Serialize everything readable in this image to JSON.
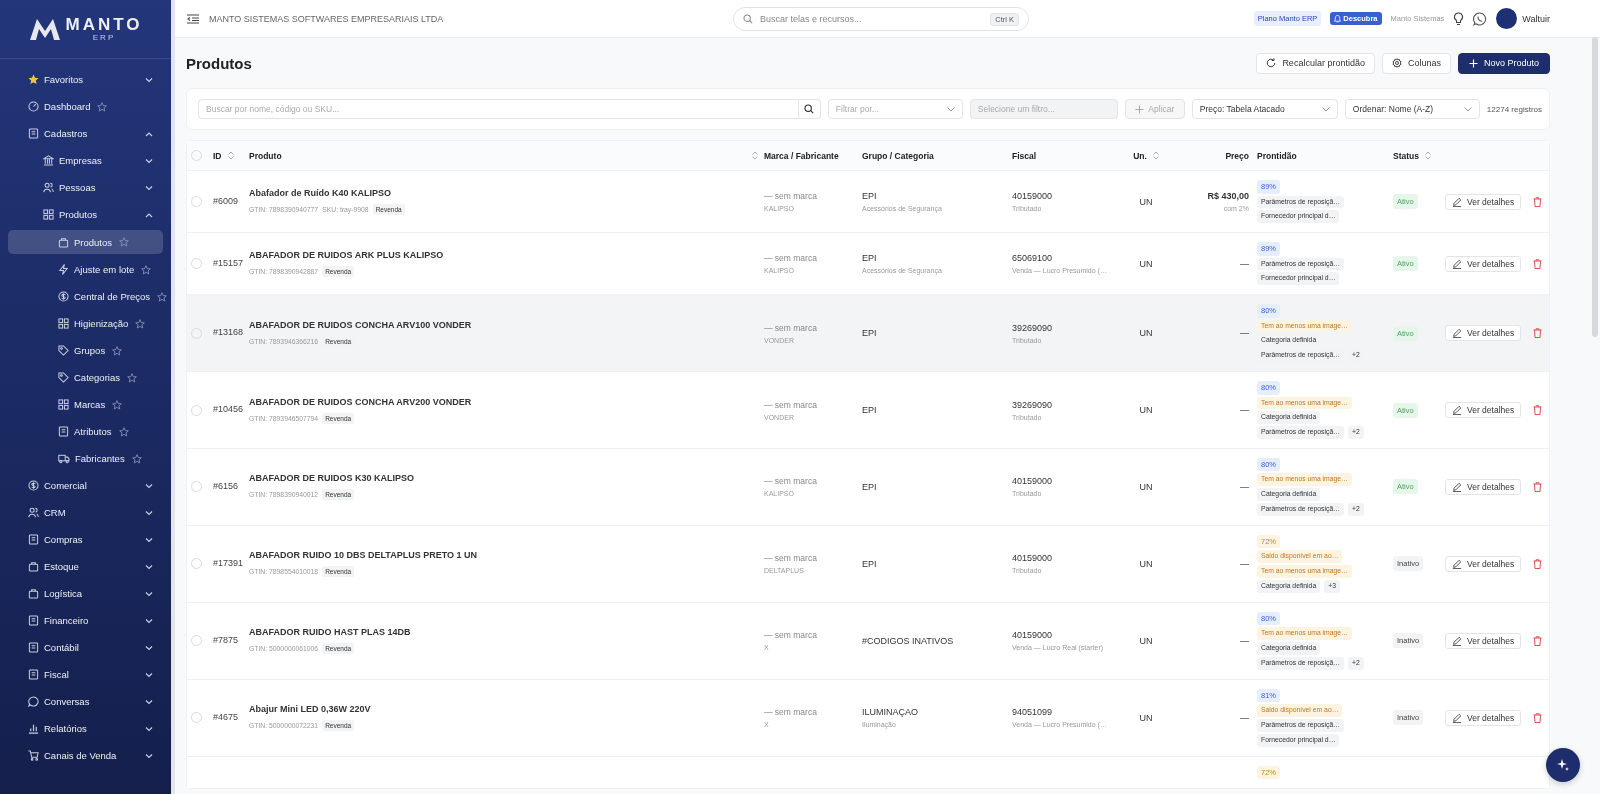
{
  "sidebar": {
    "logo": {
      "name": "MANTO",
      "sub": "ERP"
    },
    "items": [
      {
        "kind": "group",
        "label": "Favoritos",
        "expanded": false
      },
      {
        "kind": "link",
        "label": "Dashboard",
        "selected": false
      },
      {
        "kind": "group",
        "label": "Cadastros",
        "expanded": true,
        "children": [
          {
            "kind": "group",
            "label": "Empresas",
            "expanded": false
          },
          {
            "kind": "group",
            "label": "Pessoas",
            "expanded": false
          },
          {
            "kind": "group",
            "label": "Produtos",
            "expanded": true,
            "children": [
              {
                "kind": "link",
                "label": "Produtos",
                "selected": true
              },
              {
                "kind": "link",
                "label": "Ajuste em lote",
                "selected": false
              },
              {
                "kind": "link",
                "label": "Central de Preços",
                "selected": false
              },
              {
                "kind": "link",
                "label": "Higienização",
                "selected": false
              },
              {
                "kind": "link",
                "label": "Grupos",
                "selected": false
              },
              {
                "kind": "link",
                "label": "Categorias",
                "selected": false
              },
              {
                "kind": "link",
                "label": "Marcas",
                "selected": false
              },
              {
                "kind": "link",
                "label": "Atributos",
                "selected": false
              },
              {
                "kind": "link",
                "label": "Fabricantes",
                "selected": false
              }
            ]
          }
        ]
      },
      {
        "kind": "group",
        "label": "Comercial",
        "expanded": false
      },
      {
        "kind": "group",
        "label": "CRM",
        "expanded": false
      },
      {
        "kind": "group",
        "label": "Compras",
        "expanded": false
      },
      {
        "kind": "group",
        "label": "Estoque",
        "expanded": false
      },
      {
        "kind": "group",
        "label": "Logística",
        "expanded": false
      },
      {
        "kind": "group",
        "label": "Financeiro",
        "expanded": false
      },
      {
        "kind": "group",
        "label": "Contábil",
        "expanded": false
      },
      {
        "kind": "group",
        "label": "Fiscal",
        "expanded": false
      },
      {
        "kind": "group",
        "label": "Conversas",
        "expanded": false
      },
      {
        "kind": "group",
        "label": "Relatórios",
        "expanded": false
      },
      {
        "kind": "group",
        "label": "Canais de Venda",
        "expanded": false
      }
    ]
  },
  "header": {
    "company": "MANTO SISTEMAS SOFTWARES EMPRESARIAIS LTDA",
    "search": {
      "placeholder": "Buscar telas e recursos...",
      "shortcut": "Ctrl K"
    },
    "plan_badge": "Plano Manto ERP",
    "discover_button": "Descubra",
    "org": "Manto Sistemas",
    "user": "Waltuir"
  },
  "page": {
    "title": "Produtos",
    "actions": [
      {
        "kind": "refresh",
        "label": "Recalcular prontidão"
      },
      {
        "kind": "settings",
        "label": "Colunas"
      },
      {
        "kind": "primary",
        "label": "Novo Produto"
      }
    ]
  },
  "filters": {
    "search": {
      "placeholder": "Buscar por nome, código ou SKU..."
    },
    "filter_by": {
      "placeholder": "Filtrar por..."
    },
    "filter_value": {
      "placeholder": "Selecione um filtro...",
      "disabled": true
    },
    "apply": {
      "label": "Aplicar",
      "disabled": true
    },
    "price_table": "Preço: Tabela Atacado",
    "order": "Ordenar: Nome (A-Z)",
    "count": "12274 registros"
  },
  "table": {
    "select_all": {
      "checked": false
    },
    "columns": [
      {
        "label": "ID",
        "sortable": true
      },
      {
        "label": "Produto",
        "sortable": true
      },
      {
        "label": "Marca / Fabricante",
        "sortable": false
      },
      {
        "label": "Grupo / Categoria",
        "sortable": false
      },
      {
        "label": "Fiscal",
        "sortable": false
      },
      {
        "label": "Un.",
        "sortable": true
      },
      {
        "label": "Preço",
        "sortable": false
      },
      {
        "label": "Prontidão",
        "sortable": false
      },
      {
        "label": "Status",
        "sortable": true
      }
    ],
    "rows": [
      {
        "checked": false,
        "id": "#6009",
        "name": "Abafador de Ruído K40 KALIPSO",
        "meta": [
          {
            "kind": "code",
            "text": "GTIN: 7898390940777"
          },
          {
            "kind": "code",
            "text": "SKU: tray-9908"
          },
          {
            "kind": "tag",
            "text": "Revenda"
          }
        ],
        "brand": "— sem marca",
        "maker": "KALIPSO",
        "group": "EPI",
        "category": "Acessórios de Segurança",
        "ncm": "40159000",
        "tax": "Tributado",
        "unit": "UN",
        "price": "R$ 430,00",
        "price_note": "com 2%",
        "highlighted": false,
        "chips": [
          {
            "kind": "score-info",
            "text": "89%"
          },
          {
            "kind": "plain",
            "text": "Parâmetros de reposiçã…"
          },
          {
            "kind": "plain",
            "text": "Fornecedor principal d…"
          }
        ],
        "status": "Ativo",
        "active": true,
        "action": "Ver detalhes"
      },
      {
        "checked": false,
        "id": "#15157",
        "name": "ABAFADOR DE RUIDOS ARK PLUS KALIPSO",
        "meta": [
          {
            "kind": "code",
            "text": "GTIN: 7898390942887"
          },
          {
            "kind": "tag",
            "text": "Revenda"
          }
        ],
        "brand": "— sem marca",
        "maker": "KALIPSO",
        "group": "EPI",
        "category": "Acessórios de Segurança",
        "ncm": "65069100",
        "tax": "Venda — Lucro Presumido (…",
        "unit": "UN",
        "price": "—",
        "highlighted": false,
        "chips": [
          {
            "kind": "score-info",
            "text": "89%"
          },
          {
            "kind": "plain",
            "text": "Parâmetros de reposiçã…"
          },
          {
            "kind": "plain",
            "text": "Fornecedor principal d…"
          }
        ],
        "status": "Ativo",
        "active": true,
        "action": "Ver detalhes"
      },
      {
        "checked": false,
        "id": "#13168",
        "name": "ABAFADOR DE RUIDOS CONCHA ARV100 VONDER",
        "meta": [
          {
            "kind": "code",
            "text": "GTIN: 7893946366216"
          },
          {
            "kind": "tag",
            "text": "Revenda"
          }
        ],
        "brand": "— sem marca",
        "maker": "VONDER",
        "group": "EPI",
        "ncm": "39269090",
        "tax": "Tributado",
        "unit": "UN",
        "price": "—",
        "highlighted": true,
        "chips": [
          {
            "kind": "score-info",
            "text": "80%"
          },
          {
            "kind": "warn",
            "text": "Tem ao menos uma image…"
          },
          {
            "kind": "plain",
            "text": "Categoria definida"
          },
          {
            "kind": "plain",
            "text": "Parâmetros de reposiçã…"
          },
          {
            "kind": "more",
            "text": "+2"
          }
        ],
        "status": "Ativo",
        "active": true,
        "action": "Ver detalhes"
      },
      {
        "checked": false,
        "id": "#10456",
        "name": "ABAFADOR DE RUIDOS CONCHA ARV200 VONDER",
        "meta": [
          {
            "kind": "code",
            "text": "GTIN: 7893946507794"
          },
          {
            "kind": "tag",
            "text": "Revenda"
          }
        ],
        "brand": "— sem marca",
        "maker": "VONDER",
        "group": "EPI",
        "ncm": "39269090",
        "tax": "Tributado",
        "unit": "UN",
        "price": "—",
        "highlighted": false,
        "chips": [
          {
            "kind": "score-info",
            "text": "80%"
          },
          {
            "kind": "warn",
            "text": "Tem ao menos uma image…"
          },
          {
            "kind": "plain",
            "text": "Categoria definida"
          },
          {
            "kind": "plain",
            "text": "Parâmetros de reposiçã…"
          },
          {
            "kind": "more",
            "text": "+2"
          }
        ],
        "status": "Ativo",
        "active": true,
        "action": "Ver detalhes"
      },
      {
        "checked": false,
        "id": "#6156",
        "name": "ABAFADOR DE RUIDOS K30 KALIPSO",
        "meta": [
          {
            "kind": "code",
            "text": "GTIN: 7898390940012"
          },
          {
            "kind": "tag",
            "text": "Revenda"
          }
        ],
        "brand": "— sem marca",
        "maker": "KALIPSO",
        "group": "EPI",
        "ncm": "40159000",
        "tax": "Tributado",
        "unit": "UN",
        "price": "—",
        "highlighted": false,
        "chips": [
          {
            "kind": "score-info",
            "text": "80%"
          },
          {
            "kind": "warn",
            "text": "Tem ao menos uma image…"
          },
          {
            "kind": "plain",
            "text": "Categoria definida"
          },
          {
            "kind": "plain",
            "text": "Parâmetros de reposiçã…"
          },
          {
            "kind": "more",
            "text": "+2"
          }
        ],
        "status": "Ativo",
        "active": true,
        "action": "Ver detalhes"
      },
      {
        "checked": false,
        "id": "#17391",
        "name": "ABAFADOR RUIDO 10 DBS DELTAPLUS PRETO 1 UN",
        "meta": [
          {
            "kind": "code",
            "text": "GTIN: 7898554010018"
          },
          {
            "kind": "tag",
            "text": "Revenda"
          }
        ],
        "brand": "— sem marca",
        "maker": "DELTAPLUS",
        "group": "EPI",
        "ncm": "40159000",
        "tax": "Tributado",
        "unit": "UN",
        "price": "—",
        "highlighted": false,
        "chips": [
          {
            "kind": "score-warn",
            "text": "72%"
          },
          {
            "kind": "warn",
            "text": "Saldo disponível em ao…"
          },
          {
            "kind": "warn",
            "text": "Tem ao menos uma image…"
          },
          {
            "kind": "plain",
            "text": "Categoria definida"
          },
          {
            "kind": "more",
            "text": "+3"
          }
        ],
        "status": "Inativo",
        "active": false,
        "action": "Ver detalhes"
      },
      {
        "checked": false,
        "id": "#7875",
        "name": "ABAFADOR RUIDO HAST PLAS 14DB",
        "meta": [
          {
            "kind": "code",
            "text": "GTIN: 5000000061006"
          },
          {
            "kind": "tag",
            "text": "Revenda"
          }
        ],
        "brand": "— sem marca",
        "maker": "X",
        "group": "#CODIGOS INATIVOS",
        "ncm": "40159000",
        "tax": "Venda — Lucro Real (starter)",
        "unit": "UN",
        "price": "—",
        "highlighted": false,
        "chips": [
          {
            "kind": "score-info",
            "text": "80%"
          },
          {
            "kind": "warn",
            "text": "Tem ao menos uma image…"
          },
          {
            "kind": "plain",
            "text": "Categoria definida"
          },
          {
            "kind": "plain",
            "text": "Parâmetros de reposiçã…"
          },
          {
            "kind": "more",
            "text": "+2"
          }
        ],
        "status": "Inativo",
        "active": false,
        "action": "Ver detalhes"
      },
      {
        "checked": false,
        "id": "#4675",
        "name": "Abajur Mini LED 0,36W 220V",
        "meta": [
          {
            "kind": "code",
            "text": "GTIN: 5000000072231"
          },
          {
            "kind": "tag",
            "text": "Revenda"
          }
        ],
        "brand": "— sem marca",
        "maker": "X",
        "group": "ILUMINAÇAO",
        "category": "Iluminação",
        "ncm": "94051099",
        "tax": "Venda — Lucro Presumido (…",
        "unit": "UN",
        "price": "—",
        "highlighted": false,
        "chips": [
          {
            "kind": "score-info",
            "text": "81%"
          },
          {
            "kind": "warn",
            "text": "Saldo disponível em ao…"
          },
          {
            "kind": "plain",
            "text": "Parâmetros de reposiçã…"
          },
          {
            "kind": "plain",
            "text": "Fornecedor principal d…"
          }
        ],
        "status": "Inativo",
        "active": false,
        "action": "Ver detalhes"
      }
    ],
    "partial_row": {
      "chips": [
        {
          "kind": "score-warn",
          "text": "72%"
        }
      ]
    }
  }
}
